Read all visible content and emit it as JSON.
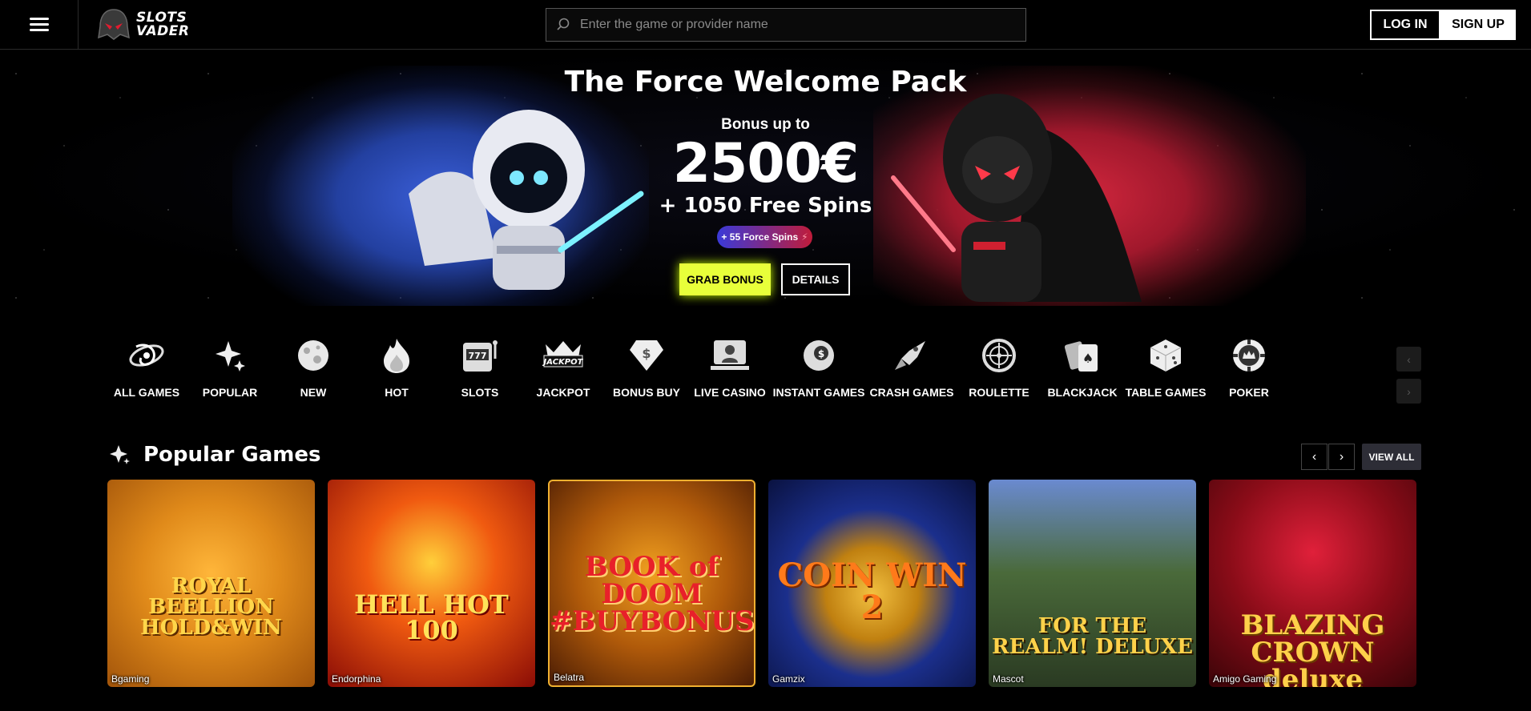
{
  "header": {
    "logo_line1": "SLOTS",
    "logo_line2": "VADER",
    "search_placeholder": "Enter the game or provider name",
    "login_label": "LOG IN",
    "signup_label": "SIGN UP"
  },
  "hero": {
    "title": "The Force Welcome Pack",
    "subtitle": "Bonus up to",
    "amount": "2500€",
    "spins": "+ 1050 Free Spins",
    "badge": "+ 55 Force Spins",
    "grab_label": "GRAB BONUS",
    "details_label": "DETAILS"
  },
  "categories": [
    {
      "label": "ALL GAMES",
      "icon": "galaxy-icon"
    },
    {
      "label": "POPULAR",
      "icon": "sparkle-icon"
    },
    {
      "label": "NEW",
      "icon": "planet-icon"
    },
    {
      "label": "HOT",
      "icon": "flame-icon"
    },
    {
      "label": "SLOTS",
      "icon": "slot-machine-icon"
    },
    {
      "label": "JACKPOT",
      "icon": "jackpot-crown-icon"
    },
    {
      "label": "BONUS BUY",
      "icon": "diamond-icon"
    },
    {
      "label": "LIVE CASINO",
      "icon": "live-dealer-icon"
    },
    {
      "label": "INSTANT GAMES",
      "icon": "instant-ball-icon"
    },
    {
      "label": "CRASH GAMES",
      "icon": "spaceship-icon"
    },
    {
      "label": "ROULETTE",
      "icon": "roulette-icon"
    },
    {
      "label": "BLACKJACK",
      "icon": "cards-icon"
    },
    {
      "label": "TABLE GAMES",
      "icon": "dice-icon"
    },
    {
      "label": "POKER",
      "icon": "poker-chip-icon"
    }
  ],
  "popular": {
    "title": "Popular Games",
    "view_all": "VIEW ALL",
    "games": [
      {
        "title": "ROYAL BEELLION HOLD&WIN",
        "provider": "Bgaming",
        "bg": "#e08a1a"
      },
      {
        "title": "HELL HOT 100",
        "provider": "Endorphina",
        "bg": "#c81e10"
      },
      {
        "title": "BOOK of DOOM #BUYBONUS",
        "provider": "Belatra",
        "bg": "#8a4a0a"
      },
      {
        "title": "COIN WIN 2",
        "provider": "Gamzix",
        "bg": "#1b2f8c"
      },
      {
        "title": "FOR THE REALM! DELUXE",
        "provider": "Mascot",
        "bg": "#3b5a3a"
      },
      {
        "title": "BLAZING CROWN deluxe",
        "provider": "Amigo Gaming",
        "bg": "#8a0c18"
      }
    ]
  },
  "colors": {
    "accent": "#e8ff3a",
    "blue_glow": "#3b5fd9",
    "red_glow": "#d6283f"
  }
}
